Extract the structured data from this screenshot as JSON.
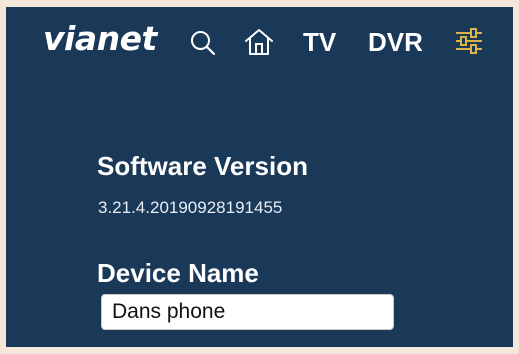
{
  "header": {
    "logo_text": "vianet",
    "nav": {
      "search_icon": "search-icon",
      "home_icon": "home-icon",
      "tv_label": "TV",
      "dvr_label": "DVR",
      "settings_icon": "sliders-icon"
    }
  },
  "software": {
    "title": "Software Version",
    "version": "3.21.4.20190928191455"
  },
  "device": {
    "title": "Device Name",
    "name_value": "Dans phone"
  },
  "colors": {
    "background": "#1a3857",
    "text": "#ffffff",
    "settings_accent": "#d9b34a",
    "frame": "#f4e6d8"
  }
}
